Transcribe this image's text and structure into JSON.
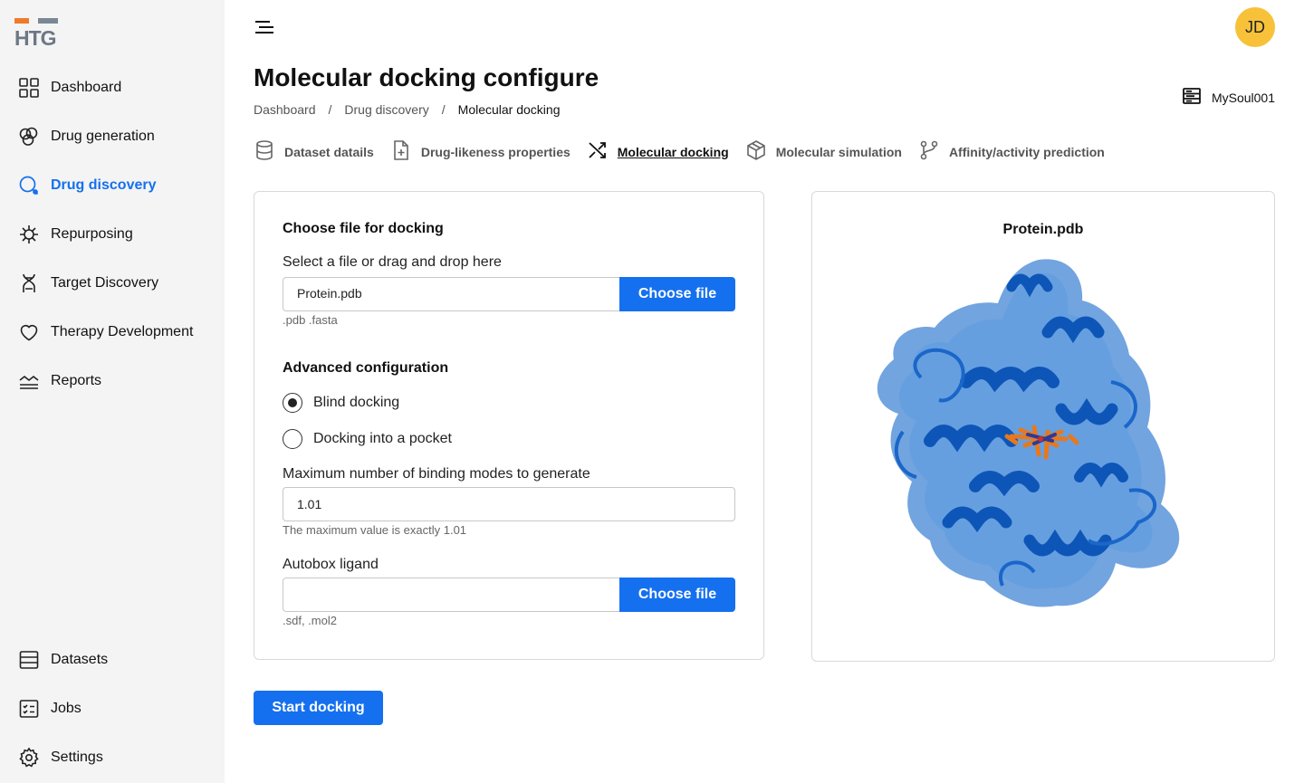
{
  "logo": {
    "text": "HTG"
  },
  "sidebar": {
    "items": [
      {
        "label": "Dashboard",
        "icon": "grid-icon"
      },
      {
        "label": "Drug generation",
        "icon": "pill-cluster-icon"
      },
      {
        "label": "Drug discovery",
        "icon": "search-molecule-icon",
        "active": true
      },
      {
        "label": "Repurposing",
        "icon": "virus-icon"
      },
      {
        "label": "Target Discovery",
        "icon": "dna-icon"
      },
      {
        "label": "Therapy Development",
        "icon": "heart-icon"
      },
      {
        "label": "Reports",
        "icon": "chart-wave-icon"
      }
    ],
    "bottom_items": [
      {
        "label": "Datasets",
        "icon": "database-icon"
      },
      {
        "label": "Jobs",
        "icon": "checklist-icon"
      },
      {
        "label": "Settings",
        "icon": "gear-icon"
      }
    ]
  },
  "header": {
    "avatar_initials": "JD",
    "title": "Molecular docking configure",
    "breadcrumb": [
      "Dashboard",
      "Drug discovery",
      "Molecular docking"
    ],
    "breadcrumb_sep": "/",
    "workspace": "MySoul001"
  },
  "steps": [
    {
      "label": "Dataset datails",
      "icon": "database-icon"
    },
    {
      "label": "Drug-likeness properties",
      "icon": "file-plus-icon"
    },
    {
      "label": "Molecular docking",
      "icon": "shuffle-icon",
      "active": true
    },
    {
      "label": "Molecular simulation",
      "icon": "cube-icon"
    },
    {
      "label": "Affinity/activity prediction",
      "icon": "branch-icon"
    }
  ],
  "form": {
    "choose_title": "Choose file for docking",
    "select_label": "Select a file or drag and drop here",
    "file_value": "Protein.pdb",
    "choose_btn": "Choose file",
    "file_hint": ".pdb .fasta",
    "advanced_title": "Advanced  configuration",
    "radio_blind": "Blind docking",
    "radio_pocket": "Docking into a pocket",
    "selected_radio": "Blind docking",
    "modes_label": "Maximum number of binding modes to generate",
    "modes_value": "1.01",
    "modes_hint": "The maximum value is exactly 1.01",
    "autobox_label": "Autobox ligand",
    "autobox_value": "",
    "autobox_btn": "Choose file",
    "autobox_hint": ".sdf, .mol2"
  },
  "preview": {
    "title": "Protein.pdb"
  },
  "actions": {
    "start": "Start docking"
  },
  "colors": {
    "accent": "#1570ef",
    "avatar": "#f7c23a",
    "sidebar_bg": "#f4f4f4"
  }
}
